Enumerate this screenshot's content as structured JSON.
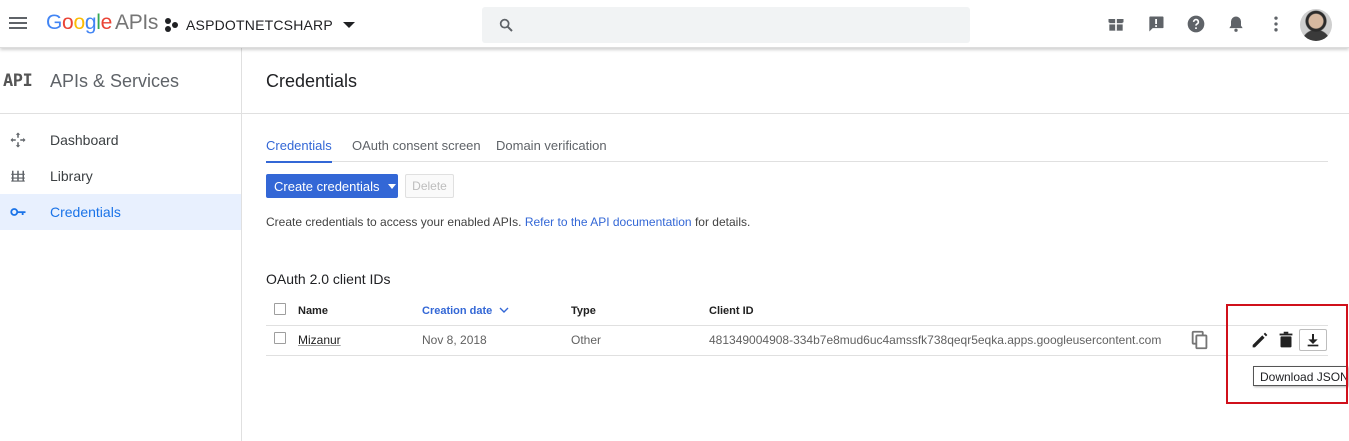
{
  "header": {
    "logo_letters": [
      "G",
      "o",
      "o",
      "g",
      "l",
      "e"
    ],
    "logo_suffix": "APIs",
    "project_name": "ASPDOTNETCSHARP",
    "search_placeholder": "",
    "icons": [
      "menu-icon",
      "project-icon",
      "search-icon",
      "gift-icon",
      "feedback-icon",
      "help-icon",
      "notifications-icon",
      "more-vert-icon",
      "avatar"
    ]
  },
  "sidebar": {
    "badge": "API",
    "title": "APIs & Services",
    "items": [
      {
        "label": "Dashboard",
        "icon": "dashboard-icon",
        "active": false
      },
      {
        "label": "Library",
        "icon": "library-icon",
        "active": false
      },
      {
        "label": "Credentials",
        "icon": "key-icon",
        "active": true
      }
    ]
  },
  "main": {
    "title": "Credentials",
    "tabs": [
      {
        "label": "Credentials",
        "active": true
      },
      {
        "label": "OAuth consent screen",
        "active": false
      },
      {
        "label": "Domain verification",
        "active": false
      }
    ],
    "create_button": "Create credentials",
    "delete_button": "Delete",
    "info_text": "Create credentials to access your enabled APIs.",
    "info_link": "Refer to the API documentation",
    "info_suffix": "for details.",
    "section_title": "OAuth 2.0 client IDs",
    "table": {
      "headers": [
        "Name",
        "Creation date",
        "Type",
        "Client ID"
      ],
      "sorted_column": "Creation date",
      "rows": [
        {
          "name": "Mizanur",
          "created": "Nov 8, 2018",
          "type": "Other",
          "client_id": "481349004908-334b7e8mud6uc4amssfk738qeqr5eqka.apps.googleusercontent.com"
        }
      ]
    },
    "row_actions": [
      "copy-icon",
      "edit-icon",
      "delete-icon",
      "download-icon"
    ],
    "tooltip": "Download JSON"
  },
  "colors": {
    "accent": "#3367d6",
    "active_nav_bg": "#e8f0fe",
    "highlight": "#d0101b"
  }
}
